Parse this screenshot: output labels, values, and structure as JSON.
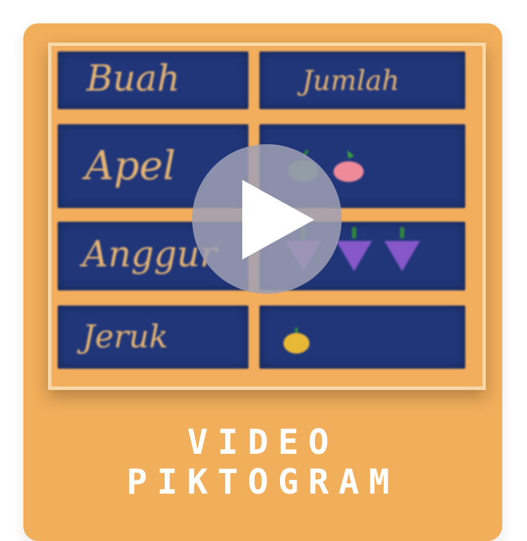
{
  "thumbnail": {
    "header_fruit": "Buah",
    "header_count": "Jumlah",
    "rows": [
      {
        "label": "Apel",
        "icon": "apple-icon",
        "count": 2
      },
      {
        "label": "Anggur",
        "icon": "grape-icon",
        "count": 3
      },
      {
        "label": "Jeruk",
        "icon": "orange-icon",
        "count": 1
      }
    ]
  },
  "caption": {
    "line1": "VIDEO",
    "line2": "PIKTOGRAM"
  },
  "colors": {
    "card": "#f1ae5b",
    "cell": "#203679",
    "handwriting": "#e4b374"
  }
}
